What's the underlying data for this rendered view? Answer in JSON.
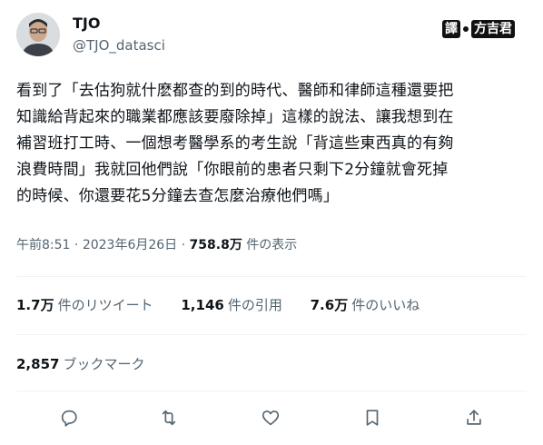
{
  "author": {
    "name": "TJO",
    "handle": "@TJO_datasci"
  },
  "translator_badge": {
    "label": "譯",
    "translator_name": "方吉君"
  },
  "tweet": {
    "lines": [
      "看到了「去估狗就什麽都查的到的時代、醫師和律師這種還要把",
      "知識給背起來的職業都應該要廢除掉」這樣的說法、讓我想到在",
      "補習班打工時、一個想考醫學系的考生說「背這些東西真的有夠",
      "浪費時間」我就回他們說「你眼前的患者只剩下2分鐘就會死掉",
      "的時候、你還要花5分鐘去查怎麼治療他們嗎」"
    ]
  },
  "meta": {
    "time": "午前8:51",
    "sep1": " · ",
    "date": "2023年6月26日",
    "sep2": " · ",
    "views_count": "758.8万",
    "views_label": " 件の表示"
  },
  "stats": {
    "retweets_count": "1.7万",
    "retweets_label": "件のリツイート",
    "quotes_count": "1,146",
    "quotes_label": "件の引用",
    "likes_count": "7.6万",
    "likes_label": "件のいいね"
  },
  "bookmarks": {
    "count": "2,857",
    "label": "ブックマーク"
  },
  "actions": [
    "reply-icon",
    "retweet-icon",
    "like-icon",
    "bookmark-icon",
    "share-icon"
  ],
  "colors": {
    "text": "#0f1419",
    "secondary": "#536471",
    "divider": "#eff3f4"
  }
}
